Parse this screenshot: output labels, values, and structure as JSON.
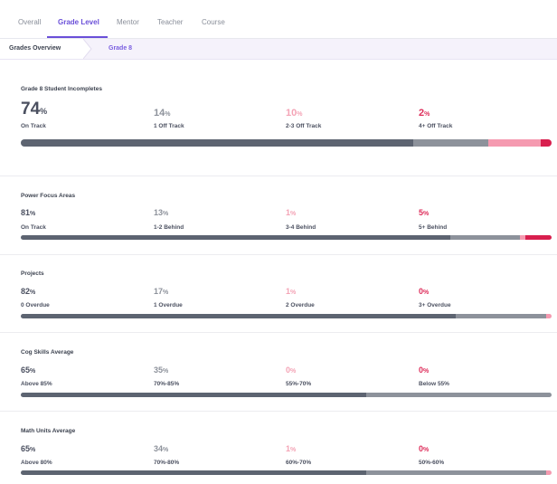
{
  "tabs": [
    {
      "label": "Overall"
    },
    {
      "label": "Grade Level"
    },
    {
      "label": "Mentor"
    },
    {
      "label": "Teacher"
    },
    {
      "label": "Course"
    }
  ],
  "active_tab": "Grade Level",
  "breadcrumb": [
    "Grades Overview",
    "Grade 8"
  ],
  "sections": [
    {
      "title": "Grade 8 Student Incompletes",
      "cols": [
        {
          "value": "74",
          "unit": "%",
          "label": "On Track"
        },
        {
          "value": "14",
          "unit": "%",
          "label": "1 Off Track"
        },
        {
          "value": "10",
          "unit": "%",
          "label": "2-3 Off Track"
        },
        {
          "value": "2",
          "unit": "%",
          "label": "4+ Off Track"
        }
      ],
      "bar": [
        74,
        14,
        10,
        2
      ]
    },
    {
      "title": "Power Focus Areas",
      "cols": [
        {
          "value": "81",
          "unit": "%",
          "label": "On Track"
        },
        {
          "value": "13",
          "unit": "%",
          "label": "1-2 Behind"
        },
        {
          "value": "1",
          "unit": "%",
          "label": "3-4 Behind"
        },
        {
          "value": "5",
          "unit": "%",
          "label": "5+ Behind"
        }
      ],
      "bar": [
        81,
        13,
        1,
        5
      ]
    },
    {
      "title": "Projects",
      "cols": [
        {
          "value": "82",
          "unit": "%",
          "label": "0 Overdue"
        },
        {
          "value": "17",
          "unit": "%",
          "label": "1 Overdue"
        },
        {
          "value": "1",
          "unit": "%",
          "label": "2 Overdue"
        },
        {
          "value": "0",
          "unit": "%",
          "label": "3+ Overdue"
        }
      ],
      "bar": [
        82,
        17,
        1,
        0
      ]
    },
    {
      "title": "Cog Skills Average",
      "cols": [
        {
          "value": "65",
          "unit": "%",
          "label": "Above 85%"
        },
        {
          "value": "35",
          "unit": "%",
          "label": "70%-85%"
        },
        {
          "value": "0",
          "unit": "%",
          "label": "55%-70%"
        },
        {
          "value": "0",
          "unit": "%",
          "label": "Below 55%"
        }
      ],
      "bar": [
        65,
        35,
        0,
        0
      ]
    },
    {
      "title": "Math Units Average",
      "cols": [
        {
          "value": "65",
          "unit": "%",
          "label": "Above 80%"
        },
        {
          "value": "34",
          "unit": "%",
          "label": "70%-80%"
        },
        {
          "value": "1",
          "unit": "%",
          "label": "60%-70%"
        },
        {
          "value": "0",
          "unit": "%",
          "label": "50%-60%"
        }
      ],
      "bar": [
        65,
        34,
        1,
        0
      ]
    }
  ],
  "colors": {
    "accent": "#6a4fd8",
    "on_track": "#5d6471",
    "minor": "#8d929b",
    "moderate": "#f59ab0",
    "severe": "#d81f4e"
  }
}
